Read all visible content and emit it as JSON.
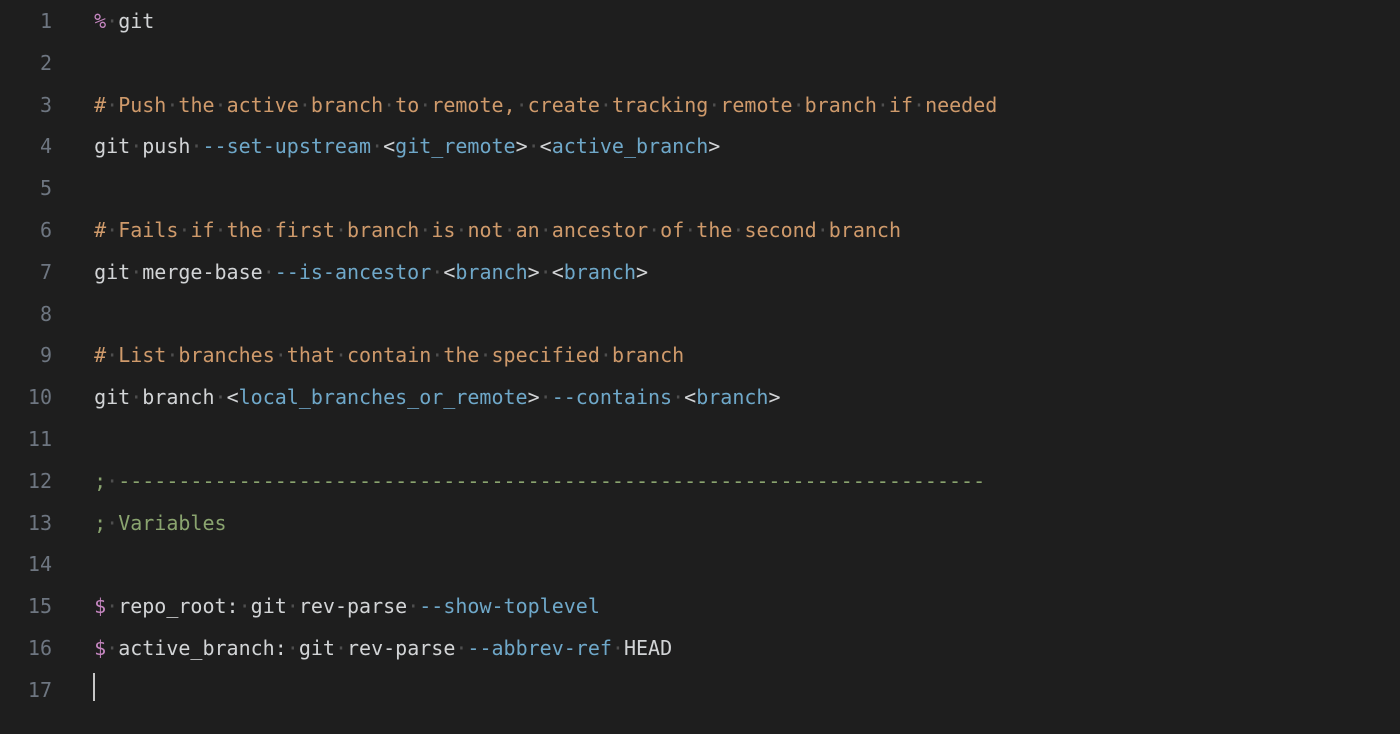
{
  "colors": {
    "background": "#1e1e1e",
    "gutter": "#6e7681",
    "default": "#d2d4d6",
    "punct": "#c586c0",
    "comment": "#cf9a6b",
    "whitespace_dot": "#4e4e4e",
    "flag": "#6fa8c9",
    "placeholder": "#6fa8c9",
    "semicolon": "#8aa46f"
  },
  "lines": [
    {
      "num": "1",
      "tokens": [
        {
          "t": "%",
          "c": "c-punct"
        },
        {
          "t": "·",
          "c": "c-dotsep"
        },
        {
          "t": "git",
          "c": "c-title"
        }
      ]
    },
    {
      "num": "2",
      "tokens": []
    },
    {
      "num": "3",
      "tokens": [
        {
          "t": "#",
          "c": "c-comment"
        },
        {
          "t": "·",
          "c": "c-dotsep"
        },
        {
          "t": "Push",
          "c": "c-comment"
        },
        {
          "t": "·",
          "c": "c-dotsep"
        },
        {
          "t": "the",
          "c": "c-comment"
        },
        {
          "t": "·",
          "c": "c-dotsep"
        },
        {
          "t": "active",
          "c": "c-comment"
        },
        {
          "t": "·",
          "c": "c-dotsep"
        },
        {
          "t": "branch",
          "c": "c-comment"
        },
        {
          "t": "·",
          "c": "c-dotsep"
        },
        {
          "t": "to",
          "c": "c-comment"
        },
        {
          "t": "·",
          "c": "c-dotsep"
        },
        {
          "t": "remote,",
          "c": "c-comment"
        },
        {
          "t": "·",
          "c": "c-dotsep"
        },
        {
          "t": "create",
          "c": "c-comment"
        },
        {
          "t": "·",
          "c": "c-dotsep"
        },
        {
          "t": "tracking",
          "c": "c-comment"
        },
        {
          "t": "·",
          "c": "c-dotsep"
        },
        {
          "t": "remote",
          "c": "c-comment"
        },
        {
          "t": "·",
          "c": "c-dotsep"
        },
        {
          "t": "branch",
          "c": "c-comment"
        },
        {
          "t": "·",
          "c": "c-dotsep"
        },
        {
          "t": "if",
          "c": "c-comment"
        },
        {
          "t": "·",
          "c": "c-dotsep"
        },
        {
          "t": "needed",
          "c": "c-comment"
        }
      ]
    },
    {
      "num": "4",
      "tokens": [
        {
          "t": "git",
          "c": "c-cmd"
        },
        {
          "t": "·",
          "c": "c-dotsep"
        },
        {
          "t": "push",
          "c": "c-cmd"
        },
        {
          "t": "·",
          "c": "c-dotsep"
        },
        {
          "t": "--set-upstream",
          "c": "c-flag"
        },
        {
          "t": "·",
          "c": "c-dotsep"
        },
        {
          "t": "<",
          "c": "c-angle"
        },
        {
          "t": "git_remote",
          "c": "c-place"
        },
        {
          "t": ">",
          "c": "c-angle"
        },
        {
          "t": "·",
          "c": "c-dotsep"
        },
        {
          "t": "<",
          "c": "c-angle"
        },
        {
          "t": "active_branch",
          "c": "c-place"
        },
        {
          "t": ">",
          "c": "c-angle"
        }
      ]
    },
    {
      "num": "5",
      "tokens": []
    },
    {
      "num": "6",
      "tokens": [
        {
          "t": "#",
          "c": "c-comment"
        },
        {
          "t": "·",
          "c": "c-dotsep"
        },
        {
          "t": "Fails",
          "c": "c-comment"
        },
        {
          "t": "·",
          "c": "c-dotsep"
        },
        {
          "t": "if",
          "c": "c-comment"
        },
        {
          "t": "·",
          "c": "c-dotsep"
        },
        {
          "t": "the",
          "c": "c-comment"
        },
        {
          "t": "·",
          "c": "c-dotsep"
        },
        {
          "t": "first",
          "c": "c-comment"
        },
        {
          "t": "·",
          "c": "c-dotsep"
        },
        {
          "t": "branch",
          "c": "c-comment"
        },
        {
          "t": "·",
          "c": "c-dotsep"
        },
        {
          "t": "is",
          "c": "c-comment"
        },
        {
          "t": "·",
          "c": "c-dotsep"
        },
        {
          "t": "not",
          "c": "c-comment"
        },
        {
          "t": "·",
          "c": "c-dotsep"
        },
        {
          "t": "an",
          "c": "c-comment"
        },
        {
          "t": "·",
          "c": "c-dotsep"
        },
        {
          "t": "ancestor",
          "c": "c-comment"
        },
        {
          "t": "·",
          "c": "c-dotsep"
        },
        {
          "t": "of",
          "c": "c-comment"
        },
        {
          "t": "·",
          "c": "c-dotsep"
        },
        {
          "t": "the",
          "c": "c-comment"
        },
        {
          "t": "·",
          "c": "c-dotsep"
        },
        {
          "t": "second",
          "c": "c-comment"
        },
        {
          "t": "·",
          "c": "c-dotsep"
        },
        {
          "t": "branch",
          "c": "c-comment"
        }
      ]
    },
    {
      "num": "7",
      "tokens": [
        {
          "t": "git",
          "c": "c-cmd"
        },
        {
          "t": "·",
          "c": "c-dotsep"
        },
        {
          "t": "merge-base",
          "c": "c-cmd"
        },
        {
          "t": "·",
          "c": "c-dotsep"
        },
        {
          "t": "--is-ancestor",
          "c": "c-flag"
        },
        {
          "t": "·",
          "c": "c-dotsep"
        },
        {
          "t": "<",
          "c": "c-angle"
        },
        {
          "t": "branch",
          "c": "c-place"
        },
        {
          "t": ">",
          "c": "c-angle"
        },
        {
          "t": "·",
          "c": "c-dotsep"
        },
        {
          "t": "<",
          "c": "c-angle"
        },
        {
          "t": "branch",
          "c": "c-place"
        },
        {
          "t": ">",
          "c": "c-angle"
        }
      ]
    },
    {
      "num": "8",
      "tokens": []
    },
    {
      "num": "9",
      "tokens": [
        {
          "t": "#",
          "c": "c-comment"
        },
        {
          "t": "·",
          "c": "c-dotsep"
        },
        {
          "t": "List",
          "c": "c-comment"
        },
        {
          "t": "·",
          "c": "c-dotsep"
        },
        {
          "t": "branches",
          "c": "c-comment"
        },
        {
          "t": "·",
          "c": "c-dotsep"
        },
        {
          "t": "that",
          "c": "c-comment"
        },
        {
          "t": "·",
          "c": "c-dotsep"
        },
        {
          "t": "contain",
          "c": "c-comment"
        },
        {
          "t": "·",
          "c": "c-dotsep"
        },
        {
          "t": "the",
          "c": "c-comment"
        },
        {
          "t": "·",
          "c": "c-dotsep"
        },
        {
          "t": "specified",
          "c": "c-comment"
        },
        {
          "t": "·",
          "c": "c-dotsep"
        },
        {
          "t": "branch",
          "c": "c-comment"
        }
      ]
    },
    {
      "num": "10",
      "tokens": [
        {
          "t": "git",
          "c": "c-cmd"
        },
        {
          "t": "·",
          "c": "c-dotsep"
        },
        {
          "t": "branch",
          "c": "c-cmd"
        },
        {
          "t": "·",
          "c": "c-dotsep"
        },
        {
          "t": "<",
          "c": "c-angle"
        },
        {
          "t": "local_branches_or_remote",
          "c": "c-place"
        },
        {
          "t": ">",
          "c": "c-angle"
        },
        {
          "t": "·",
          "c": "c-dotsep"
        },
        {
          "t": "--contains",
          "c": "c-flag"
        },
        {
          "t": "·",
          "c": "c-dotsep"
        },
        {
          "t": "<",
          "c": "c-angle"
        },
        {
          "t": "branch",
          "c": "c-place"
        },
        {
          "t": ">",
          "c": "c-angle"
        }
      ]
    },
    {
      "num": "11",
      "tokens": []
    },
    {
      "num": "12",
      "tokens": [
        {
          "t": ";",
          "c": "c-semi"
        },
        {
          "t": "·",
          "c": "c-dotsep"
        },
        {
          "t": "------------------------------------------------------------------------",
          "c": "c-semi"
        }
      ]
    },
    {
      "num": "13",
      "tokens": [
        {
          "t": ";",
          "c": "c-semi"
        },
        {
          "t": "·",
          "c": "c-dotsep"
        },
        {
          "t": "Variables",
          "c": "c-semi"
        }
      ]
    },
    {
      "num": "14",
      "tokens": []
    },
    {
      "num": "15",
      "tokens": [
        {
          "t": "$",
          "c": "c-dollar"
        },
        {
          "t": "·",
          "c": "c-dotsep"
        },
        {
          "t": "repo_root:",
          "c": "c-var"
        },
        {
          "t": "·",
          "c": "c-dotsep"
        },
        {
          "t": "git",
          "c": "c-cmd"
        },
        {
          "t": "·",
          "c": "c-dotsep"
        },
        {
          "t": "rev-parse",
          "c": "c-cmd"
        },
        {
          "t": "·",
          "c": "c-dotsep"
        },
        {
          "t": "--show-toplevel",
          "c": "c-flag"
        }
      ]
    },
    {
      "num": "16",
      "tokens": [
        {
          "t": "$",
          "c": "c-dollar"
        },
        {
          "t": "·",
          "c": "c-dotsep"
        },
        {
          "t": "active_branch:",
          "c": "c-var"
        },
        {
          "t": "·",
          "c": "c-dotsep"
        },
        {
          "t": "git",
          "c": "c-cmd"
        },
        {
          "t": "·",
          "c": "c-dotsep"
        },
        {
          "t": "rev-parse",
          "c": "c-cmd"
        },
        {
          "t": "·",
          "c": "c-dotsep"
        },
        {
          "t": "--abbrev-ref",
          "c": "c-flag"
        },
        {
          "t": "·",
          "c": "c-dotsep"
        },
        {
          "t": "HEAD",
          "c": "c-cmd"
        }
      ]
    },
    {
      "num": "17",
      "tokens": [],
      "cursor": true
    }
  ]
}
